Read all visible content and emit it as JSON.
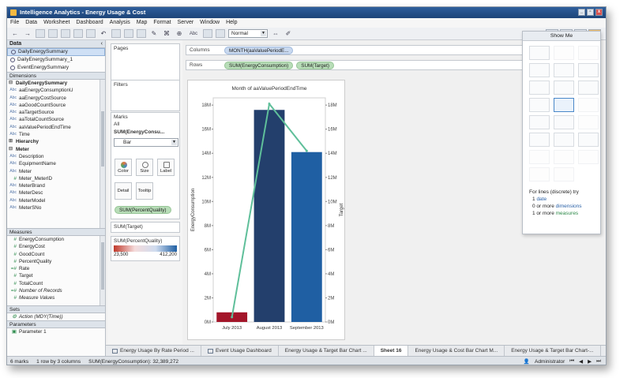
{
  "window": {
    "title": "Intelligence Analytics - Energy Usage & Cost",
    "buttons": [
      "_",
      "▫",
      "x"
    ]
  },
  "menu": [
    "File",
    "Data",
    "Worksheet",
    "Dashboard",
    "Analysis",
    "Map",
    "Format",
    "Server",
    "Window",
    "Help"
  ],
  "toolbar": {
    "fit_dropdown": "Normal",
    "abc_label": "Abc"
  },
  "data_pane": {
    "title": "Data",
    "data_sources": [
      "DailyEnergySummary",
      "DailyEnergySummary_1",
      "EventEnergySummary"
    ],
    "dimensions_label": "Dimensions",
    "dimension_groups": [
      {
        "name": "DailyEnergySummary",
        "fields": [
          {
            "type": "Abc",
            "name": "aaEnergyConsumptionU"
          },
          {
            "type": "Abc",
            "name": "aaEnergyCostSource"
          },
          {
            "type": "Abc",
            "name": "aaGoodCountSource"
          },
          {
            "type": "Abc",
            "name": "aaTargetSource"
          },
          {
            "type": "Abc",
            "name": "aaTotalCountSource"
          },
          {
            "type": "Abc",
            "name": "aaValuePeriodEndTime"
          },
          {
            "type": "Abc",
            "name": "Time"
          }
        ]
      },
      {
        "name": "Hierarchy",
        "fields": []
      },
      {
        "name": "Meter",
        "fields": [
          {
            "type": "Abc",
            "name": "Description"
          },
          {
            "type": "Abc",
            "name": "EquipmentName"
          },
          {
            "type": "Abc",
            "name": "Meter"
          },
          {
            "type": "#",
            "name": "Meter_MeterID"
          },
          {
            "type": "Abc",
            "name": "MeterBrand"
          },
          {
            "type": "Abc",
            "name": "MeterDesc"
          },
          {
            "type": "Abc",
            "name": "MeterModel"
          },
          {
            "type": "Abc",
            "name": "MeterSNo"
          }
        ]
      }
    ],
    "measures_label": "Measures",
    "measures": [
      "EnergyConsumption",
      "EnergyCost",
      "GoodCount",
      "PercentQuality",
      "Rate",
      "Target",
      "TotalCount",
      "Number of Records",
      "Measure Values"
    ],
    "sets_label": "Sets",
    "sets": [
      "Action (MDY(Time))"
    ],
    "parameters_label": "Parameters",
    "parameters": [
      "Parameter 1"
    ]
  },
  "shelves": {
    "pages_label": "Pages",
    "filters_label": "Filters",
    "marks_label": "Marks",
    "marks_all": "All",
    "marks_measure": "SUM(EnergyConsu...",
    "mark_type": "Bar",
    "mark_buttons": [
      "Color",
      "Size",
      "Label",
      "Detail",
      "Tooltip"
    ],
    "color_pill": "SUM(PercentQuality)",
    "target_legend": "SUM(Target)",
    "color_legend": {
      "title": "SUM(PercentQuality)",
      "min": "23,500",
      "max": "412,200"
    },
    "columns_label": "Columns",
    "columns_pill": "MONTH(aaValuePeriodE...",
    "rows_label": "Rows",
    "rows_pills": [
      "SUM(EnergyConsumption)",
      "SUM(Target)"
    ]
  },
  "chart_data": {
    "type": "bar",
    "title": "Month of aaValuePeriodEndTime",
    "categories": [
      "July 2013",
      "August 2013",
      "September 2013"
    ],
    "series": [
      {
        "name": "SUM(EnergyConsumption)",
        "values": [
          0.8,
          17.6,
          14.1
        ]
      },
      {
        "name": "SUM(Target)",
        "type": "line",
        "values": [
          0.4,
          18.1,
          14.2
        ]
      }
    ],
    "bar_colors": [
      "#a3162a",
      "#233f6c",
      "#1f5fa3"
    ],
    "line_color": "#5fbf9a",
    "ylabel": "EnergyConsumption",
    "y2label": "Target",
    "ylim": [
      0,
      18.6
    ],
    "y_ticks": [
      "0M",
      "2M",
      "4M",
      "6M",
      "8M",
      "10M",
      "12M",
      "14M",
      "16M",
      "18M"
    ],
    "y2_ticks": [
      "0M",
      "2M",
      "4M",
      "6M",
      "8M",
      "10M",
      "12M",
      "14M",
      "16M",
      "18M"
    ]
  },
  "show_me": {
    "title": "Show Me",
    "hint_intro": "For lines (discrete) try",
    "hint_lines": [
      {
        "count": "1",
        "text": "date"
      },
      {
        "count": "0 or more",
        "text": "dimensions"
      },
      {
        "count": "1 or more",
        "text": "measures"
      }
    ]
  },
  "tabs": [
    "Energy Usage By Rate Period ...",
    "Event Usage Dashboard",
    "Energy Usage & Target Bar Chart ...",
    "Sheet 16",
    "Energy Usage & Cost Bar Chart M...",
    "Energy Usage & Target Bar Chart-..."
  ],
  "status": {
    "marks": "6 marks",
    "rows_cols": "1 row by 3 columns",
    "sum": "SUM(EnergyConsumption): 32,389,272",
    "user": "Administrator"
  },
  "colors": {
    "accent": "#2f5f9c",
    "pill_green": "#b8ddb8",
    "pill_blue": "#c9d9ef"
  }
}
